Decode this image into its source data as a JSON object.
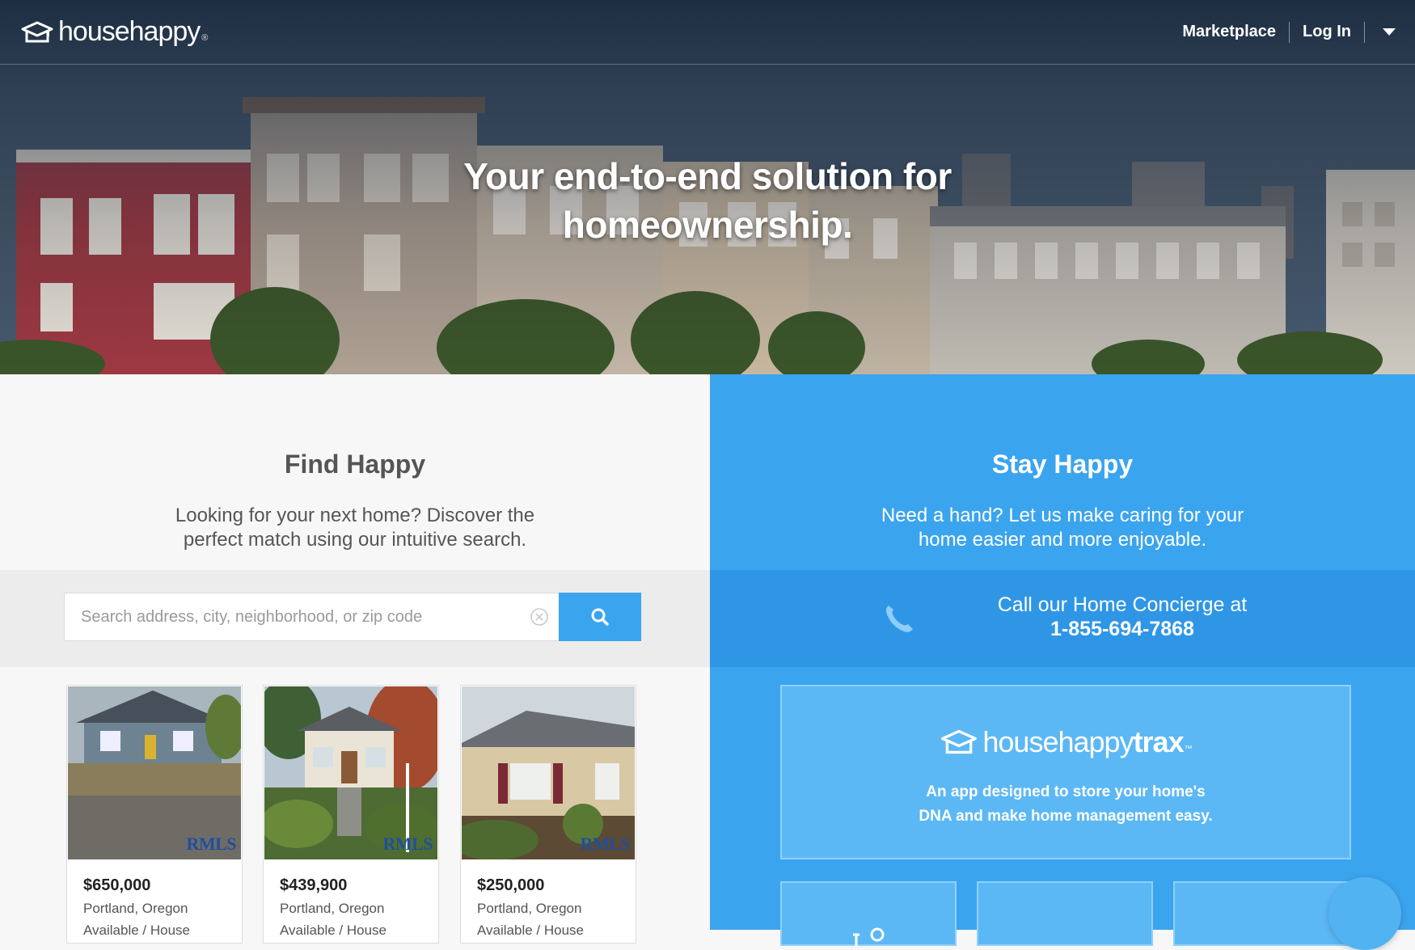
{
  "header": {
    "brand": "househappy",
    "brand_mark": "®",
    "nav": [
      {
        "label": "Marketplace"
      },
      {
        "label": "Log In"
      }
    ]
  },
  "hero": {
    "headline_line1": "Your end-to-end solution for",
    "headline_line2": "homeownership."
  },
  "find": {
    "title": "Find Happy",
    "subtitle_line1": "Looking for your next home? Discover the",
    "subtitle_line2": "perfect match using our intuitive search.",
    "search_placeholder": "Search address, city, neighborhood, or zip code",
    "search_value": "",
    "listings": [
      {
        "price": "$650,000",
        "location": "Portland, Oregon",
        "status": "Available / House",
        "watermark": "RMLS"
      },
      {
        "price": "$439,900",
        "location": "Portland, Oregon",
        "status": "Available / House",
        "watermark": "RMLS"
      },
      {
        "price": "$250,000",
        "location": "Portland, Oregon",
        "status": "Available / House",
        "watermark": "RMLS"
      }
    ]
  },
  "stay": {
    "title": "Stay Happy",
    "subtitle_line1": "Need a hand? Let us make caring for your",
    "subtitle_line2": "home easier and more enjoyable.",
    "concierge_line1": "Call our Home Concierge at",
    "concierge_phone": "1-855-694-7868",
    "trax_brand_a": "househappy",
    "trax_brand_b": "trax",
    "trax_mark": "™",
    "trax_desc_line1": "An app designed to store your home's",
    "trax_desc_line2": "DNA and make home management easy."
  },
  "colors": {
    "accent": "#3ba4ee",
    "accent_dark": "#2f96e6",
    "panel_light": "#f7f7f7"
  },
  "icons": [
    "househappy-logo-icon",
    "caret-down-icon",
    "clear-search-icon",
    "search-icon",
    "phone-icon",
    "tools-icon",
    "chat-icon"
  ]
}
